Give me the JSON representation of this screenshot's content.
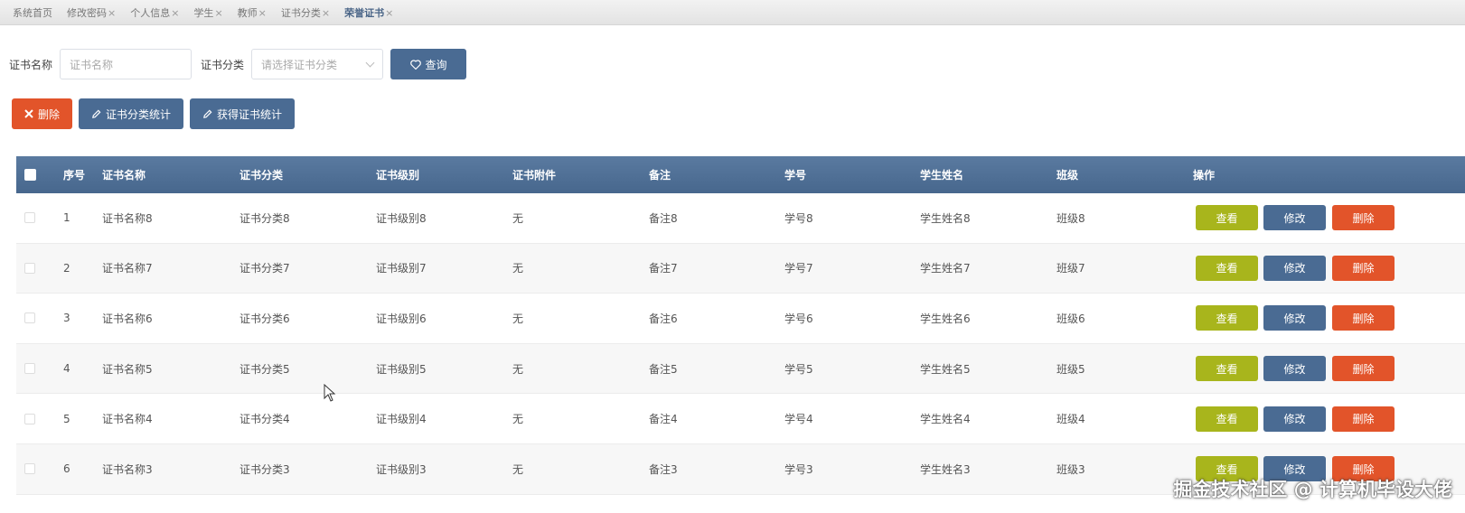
{
  "tabs": [
    {
      "label": "系统首页",
      "closable": false
    },
    {
      "label": "修改密码",
      "closable": true
    },
    {
      "label": "个人信息",
      "closable": true
    },
    {
      "label": "学生",
      "closable": true
    },
    {
      "label": "教师",
      "closable": true
    },
    {
      "label": "证书分类",
      "closable": true
    },
    {
      "label": "荣誉证书",
      "closable": true,
      "active": true
    }
  ],
  "tab_close": "×",
  "search": {
    "name_label": "证书名称",
    "name_placeholder": "证书名称",
    "category_label": "证书分类",
    "category_placeholder": "请选择证书分类",
    "query_label": "查询",
    "query_icon": "heart-icon"
  },
  "actions": {
    "delete_label": "删除",
    "delete_icon": "close-icon",
    "category_stats_label": "证书分类统计",
    "obtain_stats_label": "获得证书统计",
    "stats_icon": "pencil-icon"
  },
  "table": {
    "headers": [
      "序号",
      "证书名称",
      "证书分类",
      "证书级别",
      "证书附件",
      "备注",
      "学号",
      "学生姓名",
      "班级",
      "操作"
    ],
    "rows": [
      {
        "no": "1",
        "name": "证书名称8",
        "category": "证书分类8",
        "level": "证书级别8",
        "attachment": "无",
        "remark": "备注8",
        "student_id": "学号8",
        "student_name": "学生姓名8",
        "class": "班级8"
      },
      {
        "no": "2",
        "name": "证书名称7",
        "category": "证书分类7",
        "level": "证书级别7",
        "attachment": "无",
        "remark": "备注7",
        "student_id": "学号7",
        "student_name": "学生姓名7",
        "class": "班级7"
      },
      {
        "no": "3",
        "name": "证书名称6",
        "category": "证书分类6",
        "level": "证书级别6",
        "attachment": "无",
        "remark": "备注6",
        "student_id": "学号6",
        "student_name": "学生姓名6",
        "class": "班级6"
      },
      {
        "no": "4",
        "name": "证书名称5",
        "category": "证书分类5",
        "level": "证书级别5",
        "attachment": "无",
        "remark": "备注5",
        "student_id": "学号5",
        "student_name": "学生姓名5",
        "class": "班级5"
      },
      {
        "no": "5",
        "name": "证书名称4",
        "category": "证书分类4",
        "level": "证书级别4",
        "attachment": "无",
        "remark": "备注4",
        "student_id": "学号4",
        "student_name": "学生姓名4",
        "class": "班级4"
      },
      {
        "no": "6",
        "name": "证书名称3",
        "category": "证书分类3",
        "level": "证书级别3",
        "attachment": "无",
        "remark": "备注3",
        "student_id": "学号3",
        "student_name": "学生姓名3",
        "class": "班级3"
      }
    ],
    "op_view": "查看",
    "op_edit": "修改",
    "op_delete": "删除"
  },
  "colors": {
    "primary": "#4a6b93",
    "danger": "#e2542a",
    "view": "#a8b51c",
    "header": "#4f6f96"
  },
  "watermark": "掘金技术社区 @ 计算机毕设大佬"
}
